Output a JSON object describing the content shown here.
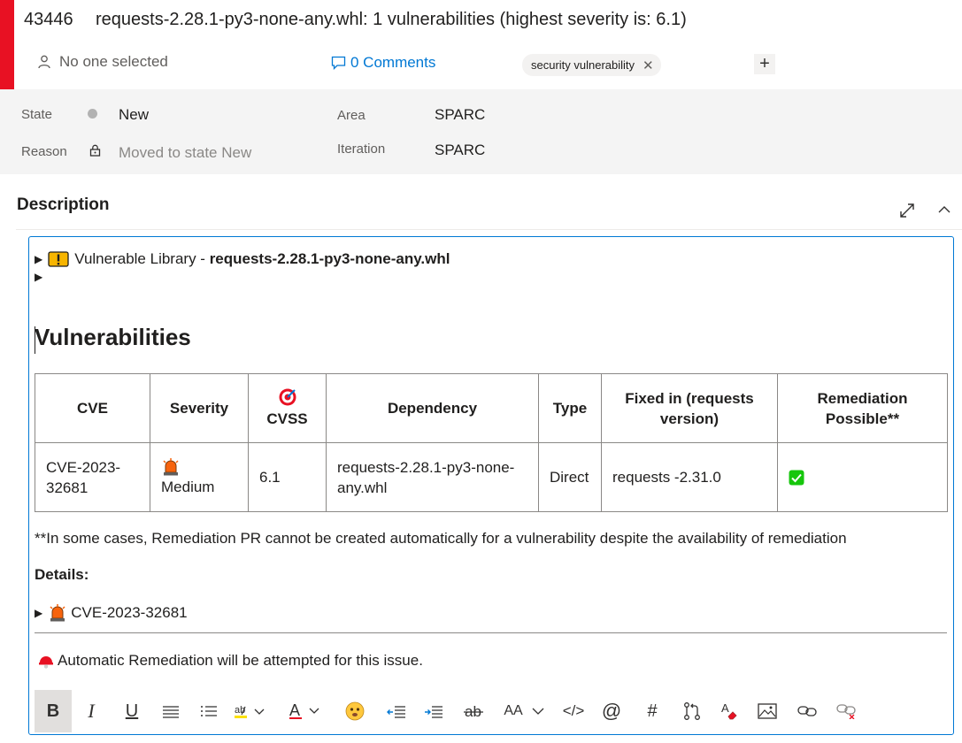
{
  "work_item": {
    "id": "43446",
    "title": "requests-2.28.1-py3-none-any.whl: 1 vulnerabilities (highest severity is: 6.1)",
    "assignee": "No one selected",
    "comments": "0 Comments",
    "tag": "security vulnerability"
  },
  "fields": {
    "state_label": "State",
    "state_value": "New",
    "reason_label": "Reason",
    "reason_value": "Moved to state New",
    "area_label": "Area",
    "area_value": "SPARC",
    "iteration_label": "Iteration",
    "iteration_value": "SPARC"
  },
  "description": {
    "title": "Description",
    "library_prefix": "Vulnerable Library - ",
    "library_name": "requests-2.28.1-py3-none-any.whl",
    "heading": "Vulnerabilities",
    "table": {
      "headers": {
        "cve": "CVE",
        "severity": "Severity",
        "cvss": "CVSS",
        "dependency": "Dependency",
        "type": "Type",
        "fixed_line1": "Fixed in (requests",
        "fixed_line2": "version)",
        "remediation_line1": "Remediation",
        "remediation_line2": "Possible**"
      },
      "row": {
        "cve_line1": "CVE-2023-",
        "cve_line2": "32681",
        "severity": "Medium",
        "cvss": "6.1",
        "dependency_line1": "requests-2.28.1-py3-none-",
        "dependency_line2": "any.whl",
        "type": "Direct",
        "fixed": "requests -2.31.0"
      }
    },
    "note": "**In some cases, Remediation PR cannot be created automatically for a vulnerability despite the availability of remediation",
    "details_label": "Details:",
    "details_cve": "CVE-2023-32681",
    "remediation_text": "Automatic Remediation will be attempted for this issue."
  },
  "toolbar": {
    "bold": "B",
    "italic": "I",
    "underline": "U",
    "font_size": "AA",
    "code": "</>",
    "mention": "@",
    "hash": "#"
  },
  "colors": {
    "accent_red": "#e81123",
    "link_blue": "#0078d4",
    "check_green": "#16c60c"
  },
  "icons": [
    "person-icon",
    "comment-icon",
    "close-icon",
    "plus-icon",
    "lock-icon",
    "expand-icon",
    "chevron-up-icon",
    "warning-icon",
    "target-icon",
    "siren-icon",
    "checkbox-icon",
    "helmet-icon"
  ]
}
